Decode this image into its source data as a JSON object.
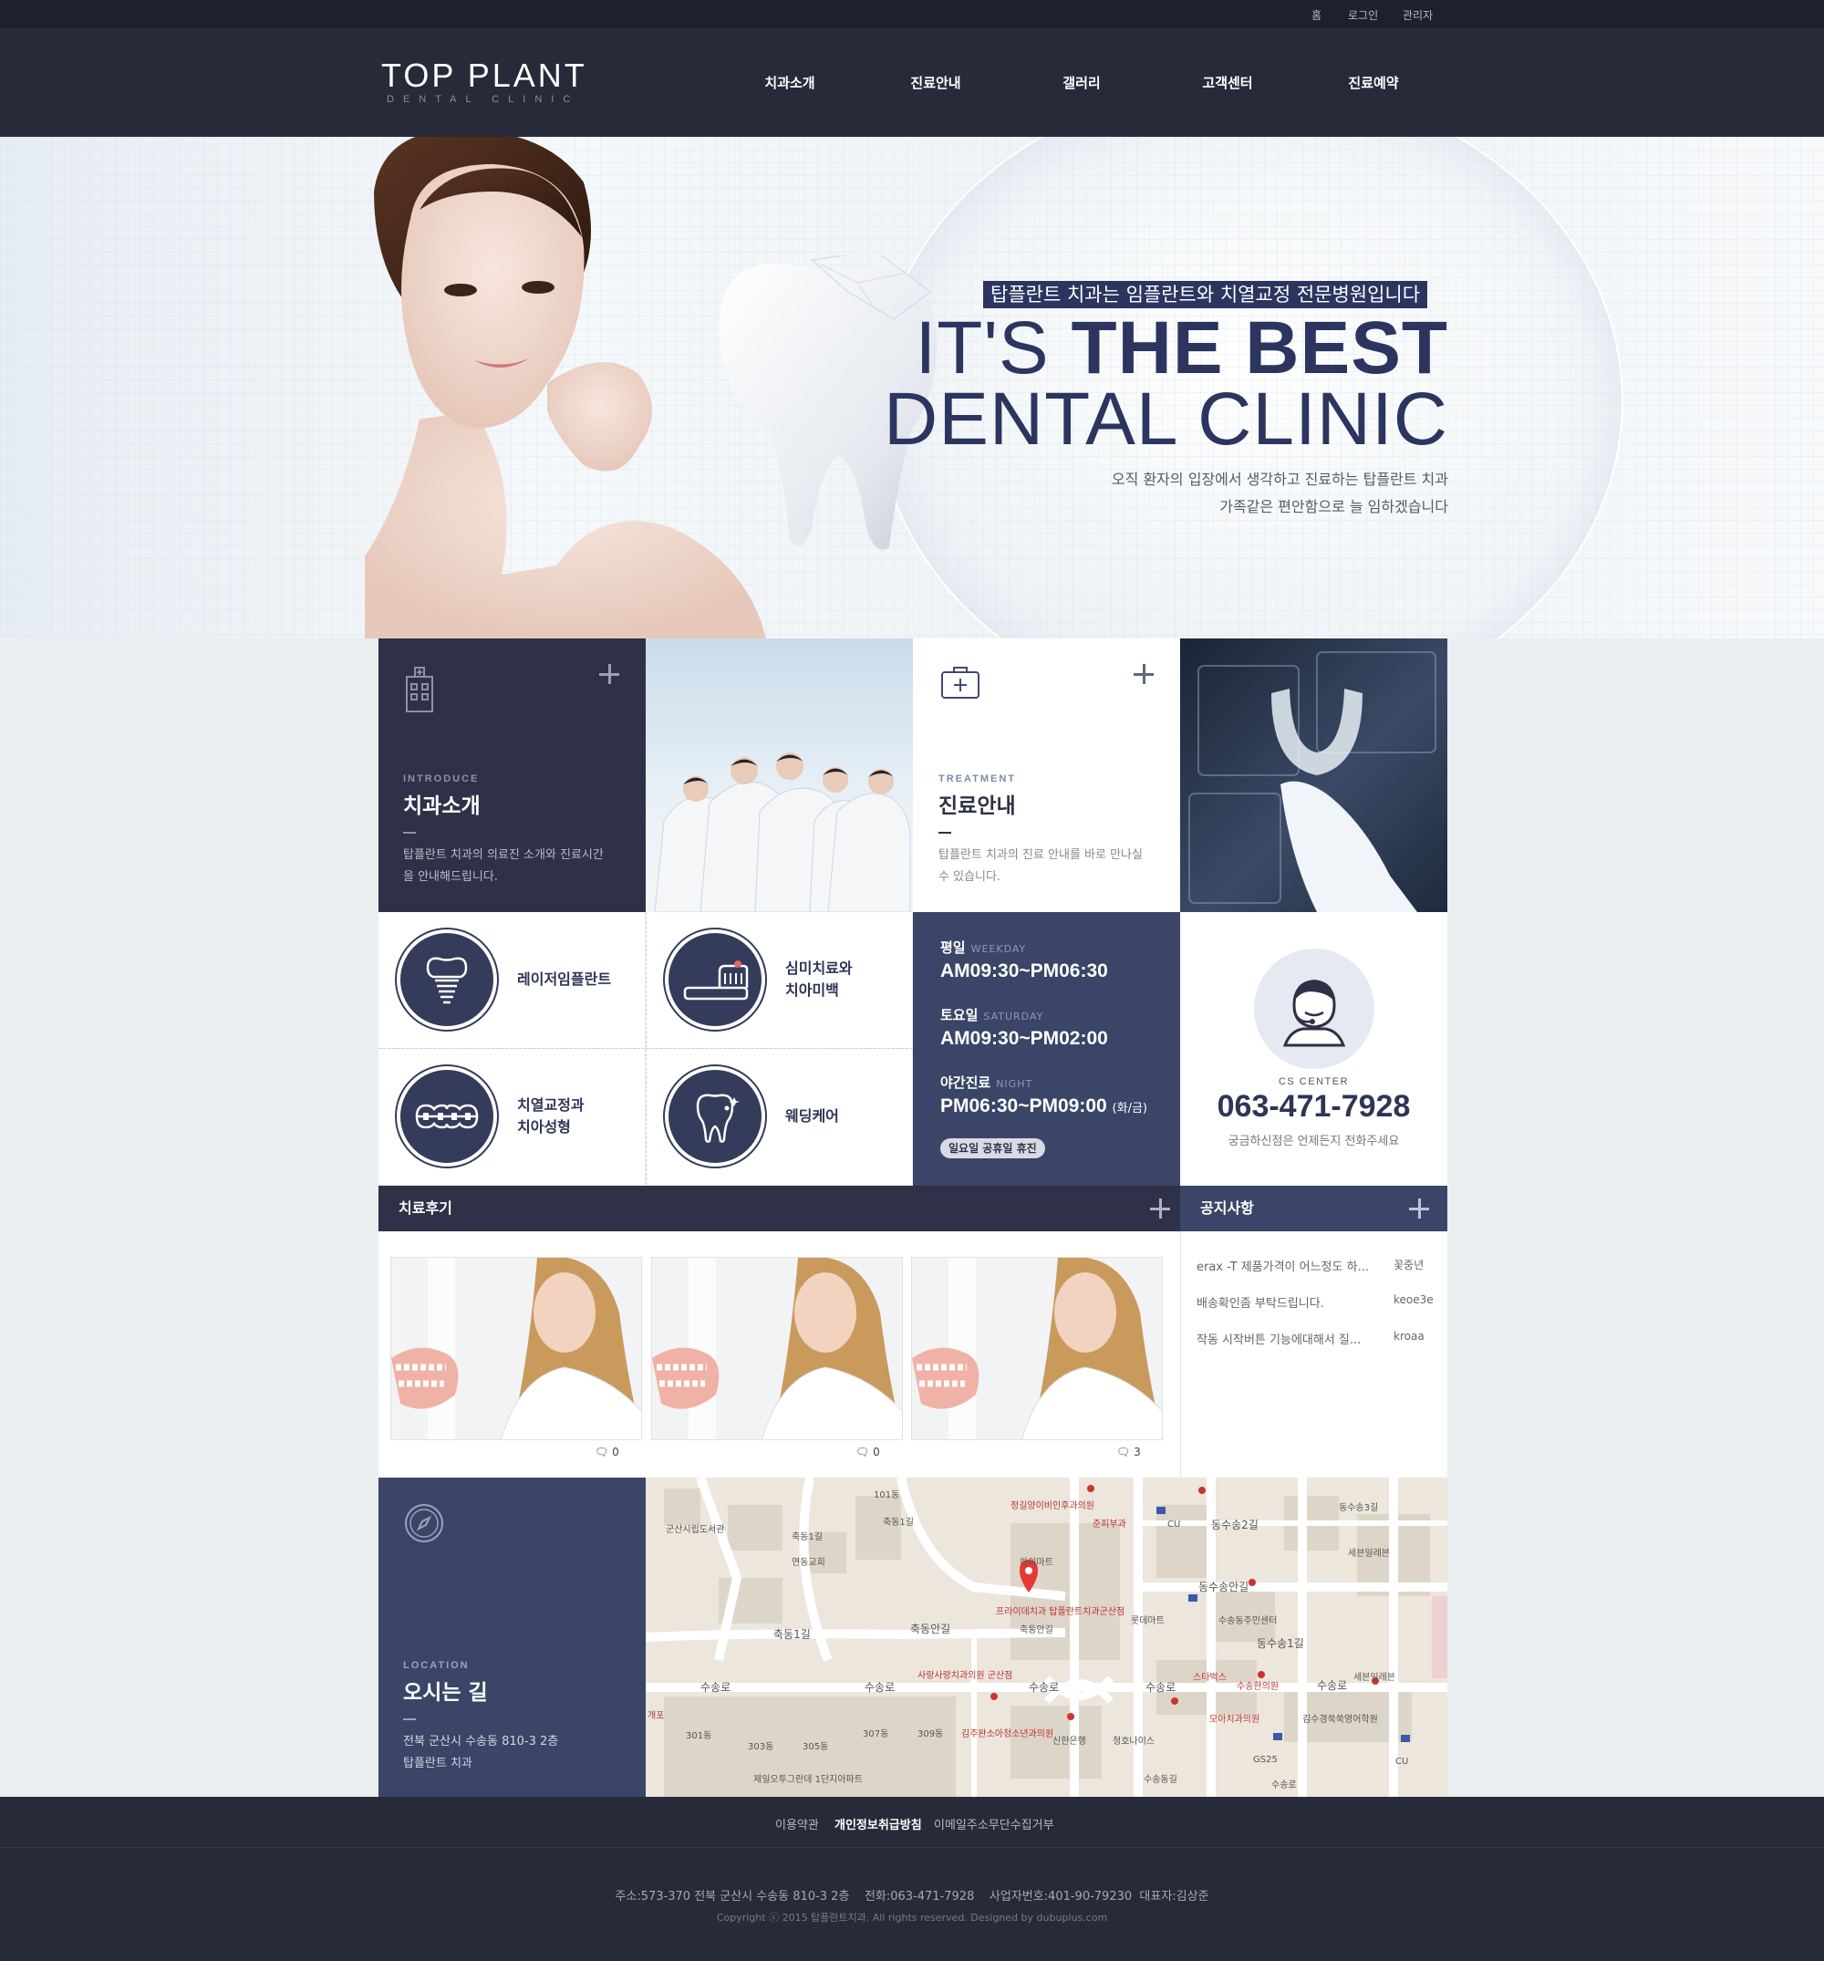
{
  "topbar": {
    "links": [
      "홈",
      "로그인",
      "관리자"
    ]
  },
  "header": {
    "logo_main": "TOP PLANT",
    "logo_sub": "DENTAL CLINIC",
    "nav": [
      "치과소개",
      "진료안내",
      "갤러리",
      "고객센터",
      "진료예약"
    ]
  },
  "hero": {
    "tag": "탑플란트 치과는 임플란트와 치열교정 전문병원입니다",
    "line1_light": "IT'S ",
    "line1_bold": "THE BEST",
    "line2": "DENTAL CLINIC",
    "sub1": "오직 환자의 입장에서 생각하고 진료하는 탑플란트 치과",
    "sub2": "가족같은 편안함으로 늘 임하겠습니다"
  },
  "introduce": {
    "category": "INTRODUCE",
    "title": "치과소개",
    "desc1": "탑플란트 치과의 의료진 소개와 진료시간",
    "desc2": "을 안내해드립니다."
  },
  "treatment": {
    "category": "TREATMENT",
    "title": "진료안내",
    "desc1": "탑플란트 치과의 진료 안내를 바로 만나실",
    "desc2": "수 있습니다."
  },
  "services": [
    {
      "line1": "레이저임플란트",
      "line2": ""
    },
    {
      "line1": "심미치료와",
      "line2": "치아미백"
    },
    {
      "line1": "치열교정과",
      "line2": "치아성형"
    },
    {
      "line1": "웨딩케어",
      "line2": ""
    }
  ],
  "hours": {
    "weekday_label": "평일",
    "weekday_en": "WEEKDAY",
    "weekday": "AM09:30~PM06:30",
    "saturday_label": "토요일",
    "saturday_en": "SATURDAY",
    "saturday": "AM09:30~PM02:00",
    "night_label": "야간진료",
    "night_en": "NIGHT",
    "night": "PM06:30~PM09:00",
    "night_note": "(화/금)",
    "closed": "일요일 공휴일 휴진"
  },
  "cs": {
    "label": "CS CENTER",
    "phone": "063-471-7928",
    "desc": "궁금하신점은 언제든지 전화주세요"
  },
  "reviews": {
    "title": "치료후기",
    "items": [
      {
        "comments": "0"
      },
      {
        "comments": "0"
      },
      {
        "comments": "3"
      }
    ]
  },
  "notices": {
    "title": "공지사항",
    "items": [
      {
        "title": "erax -T 제품가격이 어느정도 하...",
        "author": "꽃중년"
      },
      {
        "title": "배송확인좀 부탁드립니다.",
        "author": "keoe3e"
      },
      {
        "title": "작동 시작버튼 기능에대해서 질...",
        "author": "kroaa"
      }
    ]
  },
  "location": {
    "category": "LOCATION",
    "title": "오시는 길",
    "addr1": "전북 군산시 수송동 810-3 2층",
    "addr2": "탑플란트 치과"
  },
  "map": {
    "labels": [
      "101동",
      "군산시립도서관",
      "축동1길",
      "축동1길",
      "정길양이비인후과의원",
      "준피부과",
      "CU",
      "동수송2길",
      "동수송3길",
      "세븐일레븐",
      "연동교회",
      "하이마트",
      "축동안길",
      "롯데마트",
      "동수송안길",
      "수송동주민센터",
      "프라이데치과 탑플란트치과군산점",
      "동수송1길",
      "축동안길",
      "축동1길",
      "사랑사랑치과의원 군산점",
      "스타벅스",
      "세븐일레븐",
      "수송로",
      "수송로",
      "수송로",
      "수송로",
      "수송로",
      "수송한의원",
      "301동",
      "303동",
      "305동",
      "307동",
      "309동",
      "김주완소아청소년과의원",
      "신한은행",
      "청호나이스",
      "모아치과의원",
      "김수경쑥쑥영어학원",
      "제일오투그란데 1단지아파트",
      "GS25",
      "CU",
      "수송동길",
      "수송로",
      "개포"
    ]
  },
  "footer": {
    "links": [
      "이용약관",
      "개인정보취급방침",
      "이메일주소무단수집거부"
    ],
    "info": "주소:573-370 전북 군산시 수송동 810-3 2층    전화:063-471-7928    사업자번호:401-90-79230  대표자:김상준",
    "copyright": "Copyright ⓒ 2015 탑플란트치과. All rights reserved. Designed by dubuplus.com"
  },
  "colors": {
    "navy": "#2e3147",
    "accent": "#3a4567",
    "brand_text": "#2b3560"
  }
}
